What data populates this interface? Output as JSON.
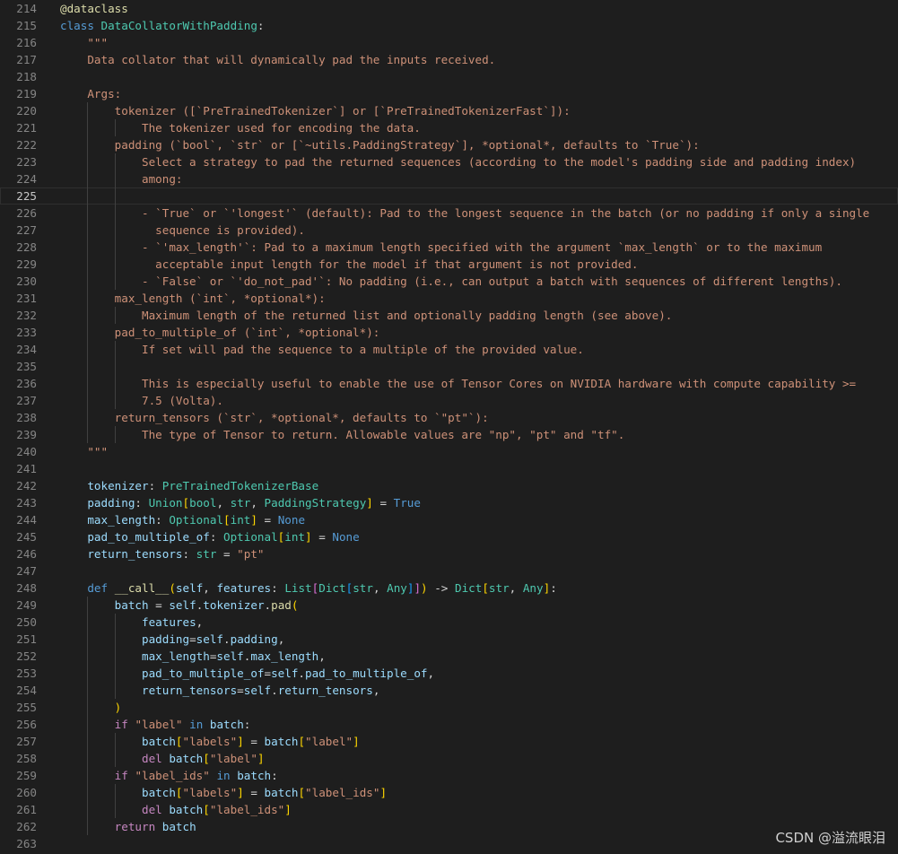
{
  "editor": {
    "current_line": 225,
    "colors": {
      "background": "#1e1e1e",
      "keyword": "#569cd6",
      "class": "#4ec9b0",
      "function": "#dcdcaa",
      "string": "#ce9178",
      "variable": "#9cdcfe",
      "operator": "#d4d4d4",
      "control": "#c586c0",
      "bracket_1": "#ffd700",
      "bracket_2": "#da70d6",
      "bracket_3": "#179fff",
      "line_number": "#858585"
    },
    "lines": [
      {
        "n": "214",
        "tokens": [
          [
            "@dataclass",
            "t-dec"
          ]
        ]
      },
      {
        "n": "215",
        "tokens": [
          [
            "class",
            "t-kw"
          ],
          [
            " ",
            ""
          ],
          [
            "DataCollatorWithPadding",
            "t-cls"
          ],
          [
            ":",
            "t-op"
          ]
        ]
      },
      {
        "n": "216",
        "tokens": [
          [
            "    \"\"\"",
            "t-str"
          ]
        ]
      },
      {
        "n": "217",
        "tokens": [
          [
            "    Data collator that will dynamically pad the inputs received.",
            "t-str"
          ]
        ]
      },
      {
        "n": "218",
        "tokens": []
      },
      {
        "n": "219",
        "tokens": [
          [
            "    Args:",
            "t-str"
          ]
        ]
      },
      {
        "n": "220",
        "tokens": [
          [
            "        tokenizer ([`PreTrainedTokenizer`] or [`PreTrainedTokenizerFast`]):",
            "t-str"
          ]
        ]
      },
      {
        "n": "221",
        "tokens": [
          [
            "            The tokenizer used for encoding the data.",
            "t-str"
          ]
        ]
      },
      {
        "n": "222",
        "tokens": [
          [
            "        padding (`bool`, `str` or [`~utils.PaddingStrategy`], *optional*, defaults to `True`):",
            "t-str"
          ]
        ]
      },
      {
        "n": "223",
        "tokens": [
          [
            "            Select a strategy to pad the returned sequences (according to the model's padding side and padding index)",
            "t-str"
          ]
        ]
      },
      {
        "n": "224",
        "tokens": [
          [
            "            among:",
            "t-str"
          ]
        ]
      },
      {
        "n": "225",
        "tokens": []
      },
      {
        "n": "226",
        "tokens": [
          [
            "            - `True` or `'longest'` (default): Pad to the longest sequence in the batch (or no padding if only a single",
            "t-str"
          ]
        ]
      },
      {
        "n": "227",
        "tokens": [
          [
            "              sequence is provided).",
            "t-str"
          ]
        ]
      },
      {
        "n": "228",
        "tokens": [
          [
            "            - `'max_length'`: Pad to a maximum length specified with the argument `max_length` or to the maximum",
            "t-str"
          ]
        ]
      },
      {
        "n": "229",
        "tokens": [
          [
            "              acceptable input length for the model if that argument is not provided.",
            "t-str"
          ]
        ]
      },
      {
        "n": "230",
        "tokens": [
          [
            "            - `False` or `'do_not_pad'`: No padding (i.e., can output a batch with sequences of different lengths).",
            "t-str"
          ]
        ]
      },
      {
        "n": "231",
        "tokens": [
          [
            "        max_length (`int`, *optional*):",
            "t-str"
          ]
        ]
      },
      {
        "n": "232",
        "tokens": [
          [
            "            Maximum length of the returned list and optionally padding length (see above).",
            "t-str"
          ]
        ]
      },
      {
        "n": "233",
        "tokens": [
          [
            "        pad_to_multiple_of (`int`, *optional*):",
            "t-str"
          ]
        ]
      },
      {
        "n": "234",
        "tokens": [
          [
            "            If set will pad the sequence to a multiple of the provided value.",
            "t-str"
          ]
        ]
      },
      {
        "n": "235",
        "tokens": []
      },
      {
        "n": "236",
        "tokens": [
          [
            "            This is especially useful to enable the use of Tensor Cores on NVIDIA hardware with compute capability >=",
            "t-str"
          ]
        ]
      },
      {
        "n": "237",
        "tokens": [
          [
            "            7.5 (Volta).",
            "t-str"
          ]
        ]
      },
      {
        "n": "238",
        "tokens": [
          [
            "        return_tensors (`str`, *optional*, defaults to `\"pt\"`):",
            "t-str"
          ]
        ]
      },
      {
        "n": "239",
        "tokens": [
          [
            "            The type of Tensor to return. Allowable values are \"np\", \"pt\" and \"tf\".",
            "t-str"
          ]
        ]
      },
      {
        "n": "240",
        "tokens": [
          [
            "    \"\"\"",
            "t-str"
          ]
        ]
      },
      {
        "n": "241",
        "tokens": []
      },
      {
        "n": "242",
        "tokens": [
          [
            "    ",
            ""
          ],
          [
            "tokenizer",
            "t-var"
          ],
          [
            ": ",
            "t-op"
          ],
          [
            "PreTrainedTokenizerBase",
            "t-cls"
          ]
        ]
      },
      {
        "n": "243",
        "tokens": [
          [
            "    ",
            ""
          ],
          [
            "padding",
            "t-var"
          ],
          [
            ": ",
            "t-op"
          ],
          [
            "Union",
            "t-cls"
          ],
          [
            "[",
            "t-br1"
          ],
          [
            "bool",
            "t-cls"
          ],
          [
            ", ",
            "t-op"
          ],
          [
            "str",
            "t-cls"
          ],
          [
            ", ",
            "t-op"
          ],
          [
            "PaddingStrategy",
            "t-cls"
          ],
          [
            "]",
            "t-br1"
          ],
          [
            " = ",
            "t-op"
          ],
          [
            "True",
            "t-kw"
          ]
        ]
      },
      {
        "n": "244",
        "tokens": [
          [
            "    ",
            ""
          ],
          [
            "max_length",
            "t-var"
          ],
          [
            ": ",
            "t-op"
          ],
          [
            "Optional",
            "t-cls"
          ],
          [
            "[",
            "t-br1"
          ],
          [
            "int",
            "t-cls"
          ],
          [
            "]",
            "t-br1"
          ],
          [
            " = ",
            "t-op"
          ],
          [
            "None",
            "t-kw"
          ]
        ]
      },
      {
        "n": "245",
        "tokens": [
          [
            "    ",
            ""
          ],
          [
            "pad_to_multiple_of",
            "t-var"
          ],
          [
            ": ",
            "t-op"
          ],
          [
            "Optional",
            "t-cls"
          ],
          [
            "[",
            "t-br1"
          ],
          [
            "int",
            "t-cls"
          ],
          [
            "]",
            "t-br1"
          ],
          [
            " = ",
            "t-op"
          ],
          [
            "None",
            "t-kw"
          ]
        ]
      },
      {
        "n": "246",
        "tokens": [
          [
            "    ",
            ""
          ],
          [
            "return_tensors",
            "t-var"
          ],
          [
            ": ",
            "t-op"
          ],
          [
            "str",
            "t-cls"
          ],
          [
            " = ",
            "t-op"
          ],
          [
            "\"pt\"",
            "t-str"
          ]
        ]
      },
      {
        "n": "247",
        "tokens": []
      },
      {
        "n": "248",
        "tokens": [
          [
            "    ",
            ""
          ],
          [
            "def",
            "t-kw"
          ],
          [
            " ",
            ""
          ],
          [
            "__call__",
            "t-fn"
          ],
          [
            "(",
            "t-br1"
          ],
          [
            "self",
            "t-var"
          ],
          [
            ", ",
            "t-op"
          ],
          [
            "features",
            "t-var"
          ],
          [
            ": ",
            "t-op"
          ],
          [
            "List",
            "t-cls"
          ],
          [
            "[",
            "t-br2"
          ],
          [
            "Dict",
            "t-cls"
          ],
          [
            "[",
            "t-br3"
          ],
          [
            "str",
            "t-cls"
          ],
          [
            ", ",
            "t-op"
          ],
          [
            "Any",
            "t-cls"
          ],
          [
            "]",
            "t-br3"
          ],
          [
            "]",
            "t-br2"
          ],
          [
            ")",
            "t-br1"
          ],
          [
            " -> ",
            "t-op"
          ],
          [
            "Dict",
            "t-cls"
          ],
          [
            "[",
            "t-br1"
          ],
          [
            "str",
            "t-cls"
          ],
          [
            ", ",
            "t-op"
          ],
          [
            "Any",
            "t-cls"
          ],
          [
            "]",
            "t-br1"
          ],
          [
            ":",
            "t-op"
          ]
        ]
      },
      {
        "n": "249",
        "tokens": [
          [
            "        ",
            ""
          ],
          [
            "batch",
            "t-var"
          ],
          [
            " = ",
            "t-op"
          ],
          [
            "self",
            "t-var"
          ],
          [
            ".",
            "t-op"
          ],
          [
            "tokenizer",
            "t-var"
          ],
          [
            ".",
            "t-op"
          ],
          [
            "pad",
            "t-fn"
          ],
          [
            "(",
            "t-br1"
          ]
        ]
      },
      {
        "n": "250",
        "tokens": [
          [
            "            ",
            ""
          ],
          [
            "features",
            "t-var"
          ],
          [
            ",",
            "t-op"
          ]
        ]
      },
      {
        "n": "251",
        "tokens": [
          [
            "            ",
            ""
          ],
          [
            "padding",
            "t-var"
          ],
          [
            "=",
            "t-op"
          ],
          [
            "self",
            "t-var"
          ],
          [
            ".",
            "t-op"
          ],
          [
            "padding",
            "t-var"
          ],
          [
            ",",
            "t-op"
          ]
        ]
      },
      {
        "n": "252",
        "tokens": [
          [
            "            ",
            ""
          ],
          [
            "max_length",
            "t-var"
          ],
          [
            "=",
            "t-op"
          ],
          [
            "self",
            "t-var"
          ],
          [
            ".",
            "t-op"
          ],
          [
            "max_length",
            "t-var"
          ],
          [
            ",",
            "t-op"
          ]
        ]
      },
      {
        "n": "253",
        "tokens": [
          [
            "            ",
            ""
          ],
          [
            "pad_to_multiple_of",
            "t-var"
          ],
          [
            "=",
            "t-op"
          ],
          [
            "self",
            "t-var"
          ],
          [
            ".",
            "t-op"
          ],
          [
            "pad_to_multiple_of",
            "t-var"
          ],
          [
            ",",
            "t-op"
          ]
        ]
      },
      {
        "n": "254",
        "tokens": [
          [
            "            ",
            ""
          ],
          [
            "return_tensors",
            "t-var"
          ],
          [
            "=",
            "t-op"
          ],
          [
            "self",
            "t-var"
          ],
          [
            ".",
            "t-op"
          ],
          [
            "return_tensors",
            "t-var"
          ],
          [
            ",",
            "t-op"
          ]
        ]
      },
      {
        "n": "255",
        "tokens": [
          [
            "        ",
            ""
          ],
          [
            ")",
            "t-br1"
          ]
        ]
      },
      {
        "n": "256",
        "tokens": [
          [
            "        ",
            ""
          ],
          [
            "if",
            "t-ctl"
          ],
          [
            " ",
            ""
          ],
          [
            "\"label\"",
            "t-str"
          ],
          [
            " ",
            ""
          ],
          [
            "in",
            "t-kw"
          ],
          [
            " ",
            ""
          ],
          [
            "batch",
            "t-var"
          ],
          [
            ":",
            "t-op"
          ]
        ]
      },
      {
        "n": "257",
        "tokens": [
          [
            "            ",
            ""
          ],
          [
            "batch",
            "t-var"
          ],
          [
            "[",
            "t-br1"
          ],
          [
            "\"labels\"",
            "t-str"
          ],
          [
            "]",
            "t-br1"
          ],
          [
            " = ",
            "t-op"
          ],
          [
            "batch",
            "t-var"
          ],
          [
            "[",
            "t-br1"
          ],
          [
            "\"label\"",
            "t-str"
          ],
          [
            "]",
            "t-br1"
          ]
        ]
      },
      {
        "n": "258",
        "tokens": [
          [
            "            ",
            ""
          ],
          [
            "del",
            "t-ctl"
          ],
          [
            " ",
            ""
          ],
          [
            "batch",
            "t-var"
          ],
          [
            "[",
            "t-br1"
          ],
          [
            "\"label\"",
            "t-str"
          ],
          [
            "]",
            "t-br1"
          ]
        ]
      },
      {
        "n": "259",
        "tokens": [
          [
            "        ",
            ""
          ],
          [
            "if",
            "t-ctl"
          ],
          [
            " ",
            ""
          ],
          [
            "\"label_ids\"",
            "t-str"
          ],
          [
            " ",
            ""
          ],
          [
            "in",
            "t-kw"
          ],
          [
            " ",
            ""
          ],
          [
            "batch",
            "t-var"
          ],
          [
            ":",
            "t-op"
          ]
        ]
      },
      {
        "n": "260",
        "tokens": [
          [
            "            ",
            ""
          ],
          [
            "batch",
            "t-var"
          ],
          [
            "[",
            "t-br1"
          ],
          [
            "\"labels\"",
            "t-str"
          ],
          [
            "]",
            "t-br1"
          ],
          [
            " = ",
            "t-op"
          ],
          [
            "batch",
            "t-var"
          ],
          [
            "[",
            "t-br1"
          ],
          [
            "\"label_ids\"",
            "t-str"
          ],
          [
            "]",
            "t-br1"
          ]
        ]
      },
      {
        "n": "261",
        "tokens": [
          [
            "            ",
            ""
          ],
          [
            "del",
            "t-ctl"
          ],
          [
            " ",
            ""
          ],
          [
            "batch",
            "t-var"
          ],
          [
            "[",
            "t-br1"
          ],
          [
            "\"label_ids\"",
            "t-str"
          ],
          [
            "]",
            "t-br1"
          ]
        ]
      },
      {
        "n": "262",
        "tokens": [
          [
            "        ",
            ""
          ],
          [
            "return",
            "t-ctl"
          ],
          [
            " ",
            ""
          ],
          [
            "batch",
            "t-var"
          ]
        ]
      },
      {
        "n": "263",
        "tokens": []
      }
    ]
  },
  "watermark": "CSDN @溢流眼泪"
}
